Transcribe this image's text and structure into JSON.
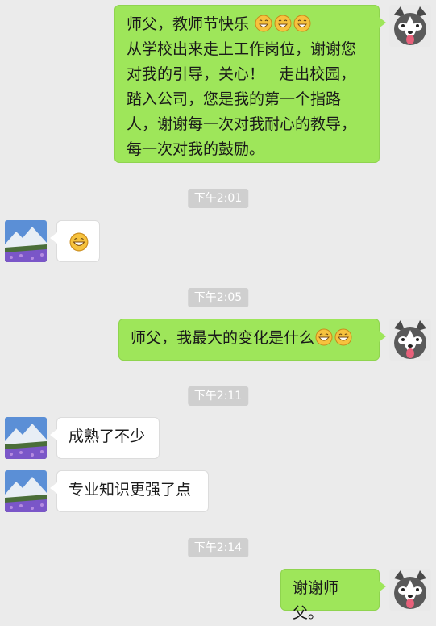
{
  "messages": [
    {
      "side": "right",
      "text": "师父，教师节快乐",
      "lines": [
        "从学校出来走上工作岗位，谢谢您",
        "对我的引导，关心！   走出校园，",
        "踏入公司，您是我的第一个指路",
        "人，谢谢每一次对我耐心的教导，",
        "每一次对我的鼓励。"
      ]
    },
    {
      "timestamp": "下午2:01"
    },
    {
      "side": "left"
    },
    {
      "timestamp": "下午2:05"
    },
    {
      "side": "right",
      "text": "师父，我最大的变化是什么"
    },
    {
      "timestamp": "下午2:11"
    },
    {
      "side": "left",
      "text": "成熟了不少"
    },
    {
      "side": "left",
      "text": "专业知识更强了点"
    },
    {
      "timestamp": "下午2:14"
    },
    {
      "side": "right",
      "text": "谢谢师父。"
    }
  ],
  "icons": {
    "my_avatar": "husky-dog-avatar",
    "their_avatar": "mountain-landscape-avatar",
    "emoji": "grinning-face-emoji"
  },
  "colors": {
    "background": "#ebebeb",
    "my_bubble": "#9ee65a",
    "their_bubble": "#ffffff",
    "timestamp_bg": "#cfcfcf"
  }
}
